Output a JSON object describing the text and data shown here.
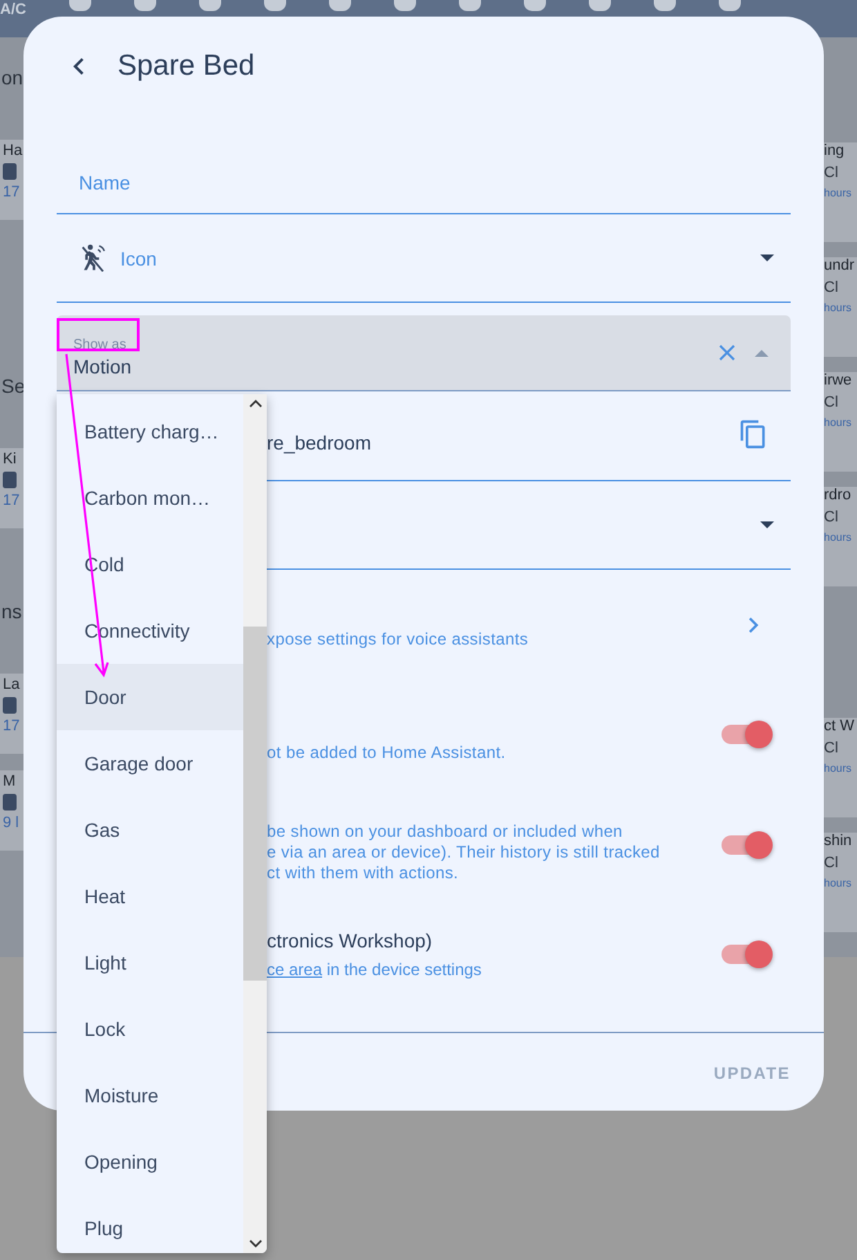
{
  "background": {
    "top_bar_label": "A/C",
    "left": [
      {
        "kind": "heading",
        "text": "on"
      },
      {
        "kind": "card",
        "title": "Ha",
        "meta": "17"
      },
      {
        "kind": "heading",
        "text": "Se"
      },
      {
        "kind": "card",
        "title": "Ki",
        "meta": "17"
      },
      {
        "kind": "heading",
        "text": "ns"
      },
      {
        "kind": "card",
        "title": "La",
        "meta": "17"
      },
      {
        "kind": "card",
        "title": "M",
        "meta": "9 l"
      }
    ],
    "right": [
      {
        "title": "ing",
        "state": "Cl",
        "meta": "hours"
      },
      {
        "title": "undr",
        "state": "Cl",
        "meta": "hours"
      },
      {
        "title": "irwe",
        "state": "Cl",
        "meta": "hours"
      },
      {
        "title": "rdro",
        "state": "Cl",
        "meta": "hours"
      },
      {
        "title": "ct W",
        "state": "Cl",
        "meta": "hours"
      },
      {
        "title": "shin",
        "state": "Cl",
        "meta": "hours"
      }
    ]
  },
  "dialog": {
    "title": "Spare Bed",
    "name_field": {
      "label": "Name"
    },
    "icon_field": {
      "label": "Icon"
    },
    "show_as": {
      "label": "Show as",
      "value": "Motion",
      "expanded": true
    },
    "entity_id": {
      "value": "re_bedroom"
    },
    "voice": {
      "text": "xpose settings for voice assistants"
    },
    "enabled": {
      "text": "ot be added to Home Assistant.",
      "on": true
    },
    "visible": {
      "lines": [
        "be shown on your dashboard or included when",
        "e via an area or device). Their history is still tracked",
        "ct with them with actions."
      ],
      "on": true
    },
    "area": {
      "title": "ctronics Workshop)",
      "link": "ce area",
      "text": " in the device settings",
      "on": true
    },
    "update_button": "UPDATE"
  },
  "dropdown": {
    "items": [
      {
        "label": "Battery charg…",
        "highlighted": false
      },
      {
        "label": "Carbon mon…",
        "highlighted": false
      },
      {
        "label": "Cold",
        "highlighted": false
      },
      {
        "label": "Connectivity",
        "highlighted": false
      },
      {
        "label": "Door",
        "highlighted": true
      },
      {
        "label": "Garage door",
        "highlighted": false
      },
      {
        "label": "Gas",
        "highlighted": false
      },
      {
        "label": "Heat",
        "highlighted": false
      },
      {
        "label": "Light",
        "highlighted": false
      },
      {
        "label": "Lock",
        "highlighted": false
      },
      {
        "label": "Moisture",
        "highlighted": false
      },
      {
        "label": "Opening",
        "highlighted": false
      },
      {
        "label": "Plug",
        "highlighted": false
      }
    ]
  }
}
